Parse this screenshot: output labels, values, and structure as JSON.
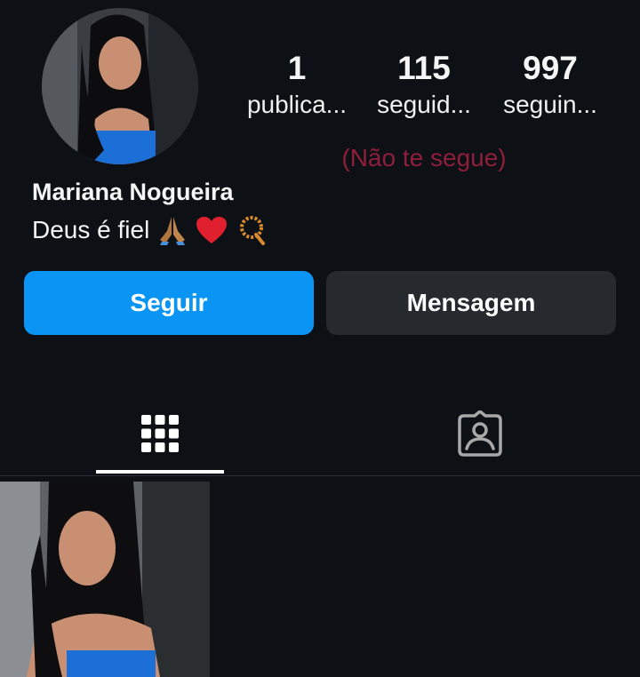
{
  "profile": {
    "name": "Mariana Nogueira",
    "bio_text": "Deus é fiel",
    "bio_emojis": [
      "folded-hands-icon",
      "red-heart-icon",
      "prayer-beads-icon"
    ]
  },
  "stats": [
    {
      "value": "1",
      "label": "publica..."
    },
    {
      "value": "115",
      "label": "seguid..."
    },
    {
      "value": "997",
      "label": "seguin..."
    }
  ],
  "status": "(Não te segue)",
  "buttons": {
    "follow": "Seguir",
    "message": "Mensagem"
  },
  "tabs": {
    "grid_icon": "grid-icon",
    "tagged_icon": "tagged-person-icon"
  },
  "colors": {
    "background": "#0d1014",
    "follow_button": "#0a95f5",
    "message_button": "#26292e",
    "status_text": "#8f1e3b"
  }
}
